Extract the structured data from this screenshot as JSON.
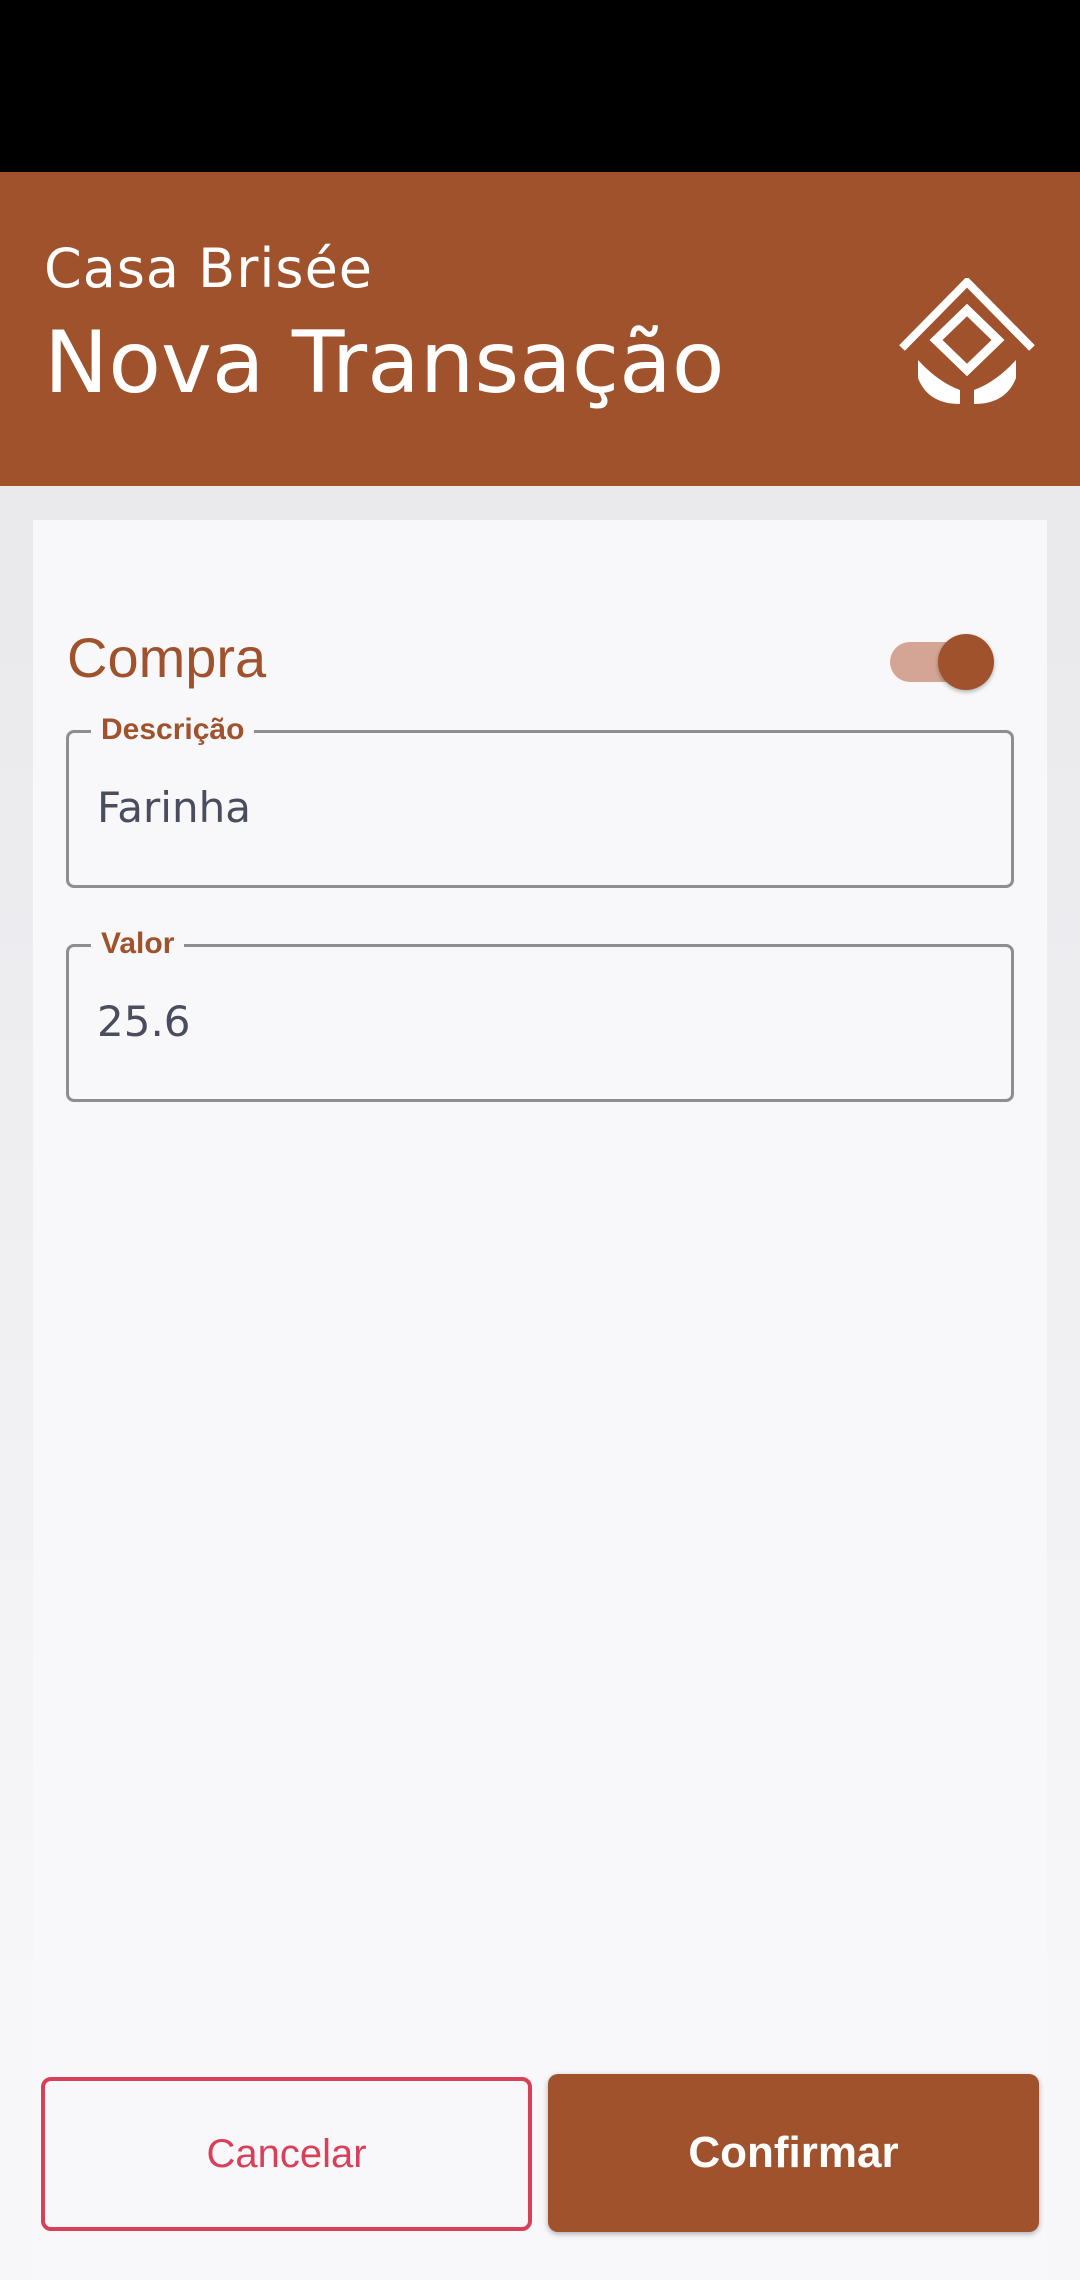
{
  "header": {
    "subtitle": "Casa Brisée",
    "title": "Nova Transação",
    "logo_icon": "house-diamond-logo-icon",
    "background_color": "#a0522d"
  },
  "form": {
    "toggle_label": "Compra",
    "toggle_on": true,
    "fields": [
      {
        "label": "Descrição",
        "value": "Farinha"
      },
      {
        "label": "Valor",
        "value": "25.6"
      }
    ]
  },
  "actions": {
    "cancel_label": "Cancelar",
    "confirm_label": "Confirmar",
    "cancel_color": "#d8405a",
    "confirm_color": "#a0522d"
  }
}
